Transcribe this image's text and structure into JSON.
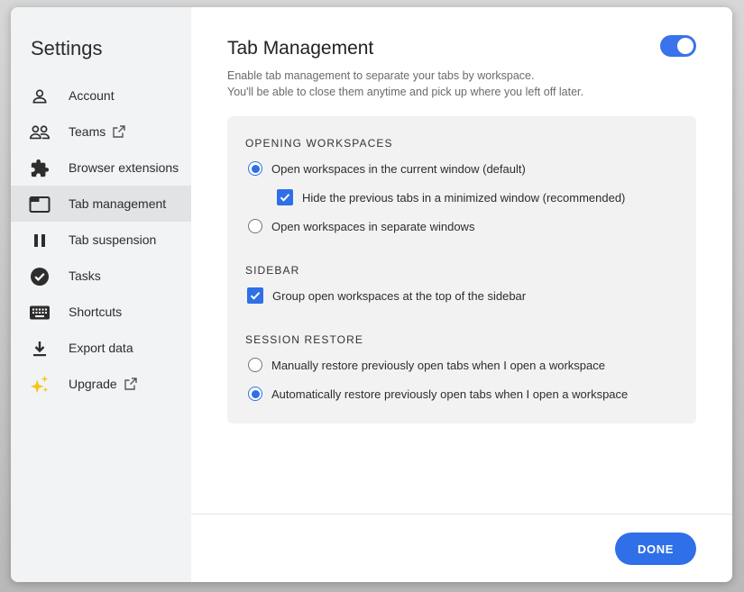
{
  "sidebar": {
    "title": "Settings",
    "items": [
      {
        "label": "Account",
        "icon": "person-icon",
        "external": false
      },
      {
        "label": "Teams",
        "icon": "people-icon",
        "external": true
      },
      {
        "label": "Browser extensions",
        "icon": "puzzle-icon",
        "external": false
      },
      {
        "label": "Tab management",
        "icon": "tab-icon",
        "external": false,
        "active": true
      },
      {
        "label": "Tab suspension",
        "icon": "pause-icon",
        "external": false
      },
      {
        "label": "Tasks",
        "icon": "check-circle-icon",
        "external": false
      },
      {
        "label": "Shortcuts",
        "icon": "keyboard-icon",
        "external": false
      },
      {
        "label": "Export data",
        "icon": "download-icon",
        "external": false
      },
      {
        "label": "Upgrade",
        "icon": "sparkle-icon",
        "external": true
      }
    ]
  },
  "main": {
    "title": "Tab Management",
    "toggle_on": true,
    "description_line1": "Enable tab management to separate your tabs by workspace.",
    "description_line2": "You'll be able to close them anytime and pick up where you left off later.",
    "sections": {
      "opening": {
        "heading": "OPENING WORKSPACES",
        "options": [
          {
            "label": "Open workspaces in the current window (default)",
            "checked": true
          },
          {
            "label": "Hide the previous tabs in a minimized window (recommended)",
            "checked": true
          },
          {
            "label": "Open workspaces in separate windows",
            "checked": false
          }
        ]
      },
      "sidebar": {
        "heading": "SIDEBAR",
        "options": [
          {
            "label": "Group open workspaces at the top of the sidebar",
            "checked": true
          }
        ]
      },
      "session": {
        "heading": "SESSION RESTORE",
        "options": [
          {
            "label": "Manually restore previously open tabs when I open a workspace",
            "checked": false
          },
          {
            "label": "Automatically restore previously open tabs when I open a workspace",
            "checked": true
          }
        ]
      }
    }
  },
  "footer": {
    "done_label": "DONE"
  },
  "colors": {
    "accent": "#2f6fe8",
    "sidebar_bg": "#f1f3f4",
    "active_item_bg": "#e2e3e5",
    "panel_bg": "#f2f2f3",
    "upgrade_icon": "#f5c518"
  }
}
